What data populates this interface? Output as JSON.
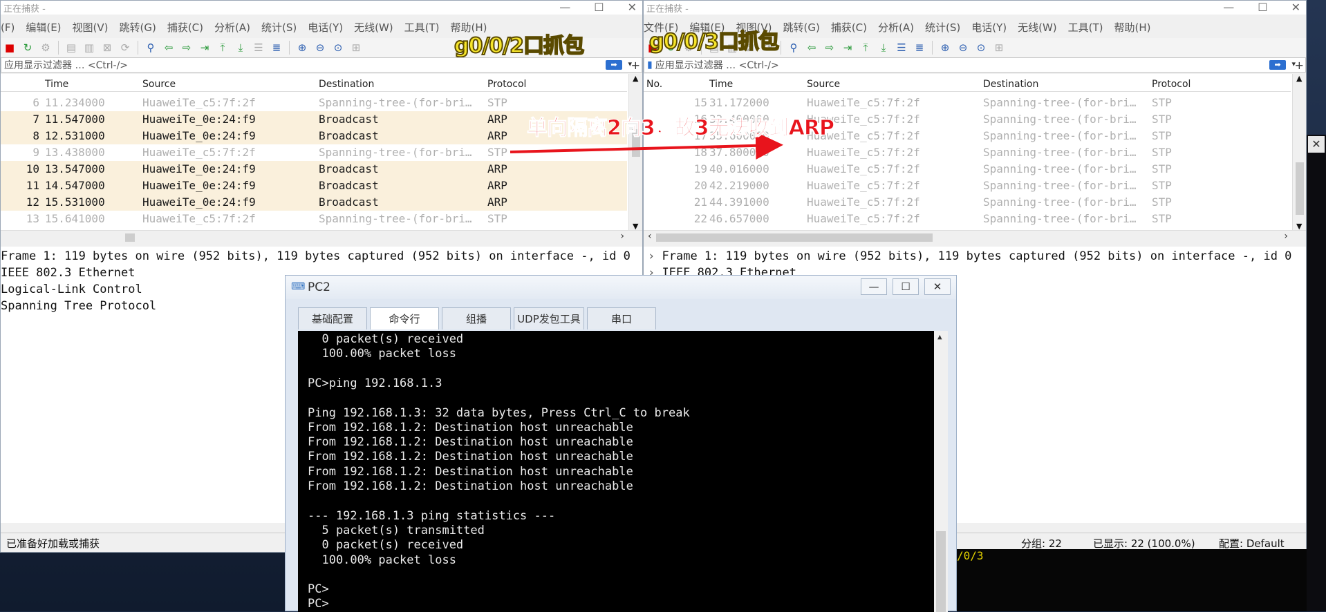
{
  "left_window": {
    "title": "正在捕获 -",
    "menu": [
      "(F)",
      "编辑(E)",
      "视图(V)",
      "跳转(G)",
      "捕获(C)",
      "分析(A)",
      "统计(S)",
      "电话(Y)",
      "无线(W)",
      "工具(T)",
      "帮助(H)"
    ],
    "annotation": "g0/0/2口抓包",
    "filter_placeholder": "应用显示过滤器 … <Ctrl-/>",
    "columns": {
      "time": "Time",
      "source": "Source",
      "destination": "Destination",
      "protocol": "Protocol"
    },
    "packets": [
      {
        "no": "6",
        "time": "11.234000",
        "src": "HuaweiTe_c5:7f:2f",
        "dst": "Spanning-tree-(for-bri…",
        "proto": "STP",
        "kind": "stp"
      },
      {
        "no": "7",
        "time": "11.547000",
        "src": "HuaweiTe_0e:24:f9",
        "dst": "Broadcast",
        "proto": "ARP",
        "kind": "arp"
      },
      {
        "no": "8",
        "time": "12.531000",
        "src": "HuaweiTe_0e:24:f9",
        "dst": "Broadcast",
        "proto": "ARP",
        "kind": "arp"
      },
      {
        "no": "9",
        "time": "13.438000",
        "src": "HuaweiTe_c5:7f:2f",
        "dst": "Spanning-tree-(for-bri…",
        "proto": "STP",
        "kind": "stp"
      },
      {
        "no": "10",
        "time": "13.547000",
        "src": "HuaweiTe_0e:24:f9",
        "dst": "Broadcast",
        "proto": "ARP",
        "kind": "arp"
      },
      {
        "no": "11",
        "time": "14.547000",
        "src": "HuaweiTe_0e:24:f9",
        "dst": "Broadcast",
        "proto": "ARP",
        "kind": "arp"
      },
      {
        "no": "12",
        "time": "15.531000",
        "src": "HuaweiTe_0e:24:f9",
        "dst": "Broadcast",
        "proto": "ARP",
        "kind": "arp"
      },
      {
        "no": "13",
        "time": "15.641000",
        "src": "HuaweiTe_c5:7f:2f",
        "dst": "Spanning-tree-(for-bri…",
        "proto": "STP",
        "kind": "stp"
      }
    ],
    "detail": [
      "Frame 1: 119 bytes on wire (952 bits), 119 bytes captured (952 bits) on interface -, id 0",
      "IEEE 802.3 Ethernet",
      "Logical-Link Control",
      "Spanning Tree Protocol"
    ],
    "status": "已准备好加载或捕获"
  },
  "right_window": {
    "title": "正在捕获 -",
    "menu": [
      "文件(F)",
      "编辑(E)",
      "视图(V)",
      "跳转(G)",
      "捕获(C)",
      "分析(A)",
      "统计(S)",
      "电话(Y)",
      "无线(W)",
      "工具(T)",
      "帮助(H)"
    ],
    "annotation": "g0/0/3口抓包",
    "filter_placeholder": "应用显示过滤器 … <Ctrl-/>",
    "columns": {
      "no": "No.",
      "time": "Time",
      "source": "Source",
      "destination": "Destination",
      "protocol": "Protocol"
    },
    "packets": [
      {
        "no": "15",
        "time": "31.172000",
        "src": "HuaweiTe_c5:7f:2f",
        "dst": "Spanning-tree-(for-bri…",
        "proto": "STP"
      },
      {
        "no": "16",
        "time": "33.400000",
        "src": "HuaweiTe_c5:7f:2f",
        "dst": "Spanning-tree-(for-bri…",
        "proto": "STP"
      },
      {
        "no": "17",
        "time": "35.600000",
        "src": "HuaweiTe_c5:7f:2f",
        "dst": "Spanning-tree-(for-bri…",
        "proto": "STP"
      },
      {
        "no": "18",
        "time": "37.800000",
        "src": "HuaweiTe_c5:7f:2f",
        "dst": "Spanning-tree-(for-bri…",
        "proto": "STP"
      },
      {
        "no": "19",
        "time": "40.016000",
        "src": "HuaweiTe_c5:7f:2f",
        "dst": "Spanning-tree-(for-bri…",
        "proto": "STP"
      },
      {
        "no": "20",
        "time": "42.219000",
        "src": "HuaweiTe_c5:7f:2f",
        "dst": "Spanning-tree-(for-bri…",
        "proto": "STP"
      },
      {
        "no": "21",
        "time": "44.391000",
        "src": "HuaweiTe_c5:7f:2f",
        "dst": "Spanning-tree-(for-bri…",
        "proto": "STP"
      },
      {
        "no": "22",
        "time": "46.657000",
        "src": "HuaweiTe_c5:7f:2f",
        "dst": "Spanning-tree-(for-bri…",
        "proto": "STP"
      }
    ],
    "detail": [
      "Frame 1: 119 bytes on wire (952 bits), 119 bytes captured (952 bits) on interface -, id 0",
      "IEEE 802.3 Ethernet"
    ],
    "status_packets": "分组: 22",
    "status_displayed": "已显示: 22 (100.0%)",
    "status_profile": "配置: Default"
  },
  "arrow_annotation": "单向隔离2向3，故3无法收到ARP",
  "pc2": {
    "title": "PC2",
    "tabs": [
      "基础配置",
      "命令行",
      "组播",
      "UDP发包工具",
      "串口"
    ],
    "terminal_lines": [
      "  0 packet(s) received",
      "  100.00% packet loss",
      "",
      "PC>ping 192.168.1.3",
      "",
      "Ping 192.168.1.3: 32 data bytes, Press Ctrl_C to break",
      "From 192.168.1.2: Destination host unreachable",
      "From 192.168.1.2: Destination host unreachable",
      "From 192.168.1.2: Destination host unreachable",
      "From 192.168.1.2: Destination host unreachable",
      "From 192.168.1.2: Destination host unreachable",
      "",
      "--- 192.168.1.3 ping statistics ---",
      "  5 packet(s) transmitted",
      "  0 packet(s) received",
      "  100.00% packet loss",
      "",
      "PC>",
      "PC>"
    ]
  },
  "bg_terminal_text": "/0/3"
}
